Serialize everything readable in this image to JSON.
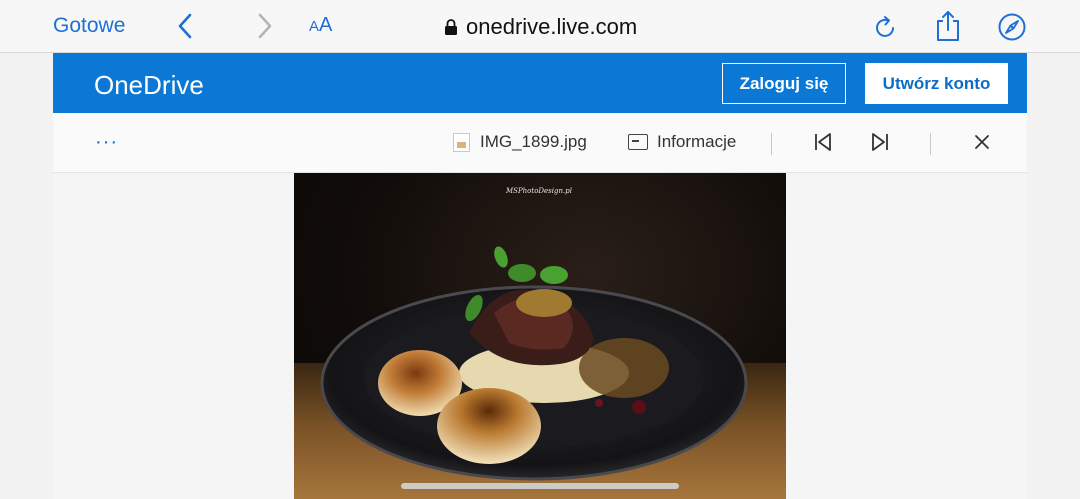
{
  "browser": {
    "done_label": "Gotowe",
    "text_size_label_small": "A",
    "text_size_label_large": "A",
    "url": "onedrive.live.com",
    "accent_color": "#1f6fd6"
  },
  "header": {
    "brand": "OneDrive",
    "signin_label": "Zaloguj się",
    "create_account_label": "Utwórz konto",
    "brand_color": "#0a78d4"
  },
  "toolbar": {
    "more_label": "···",
    "file_name": "IMG_1899.jpg",
    "info_label": "Informacje"
  },
  "photo": {
    "watermark": "MSPhotoDesign.pl"
  }
}
